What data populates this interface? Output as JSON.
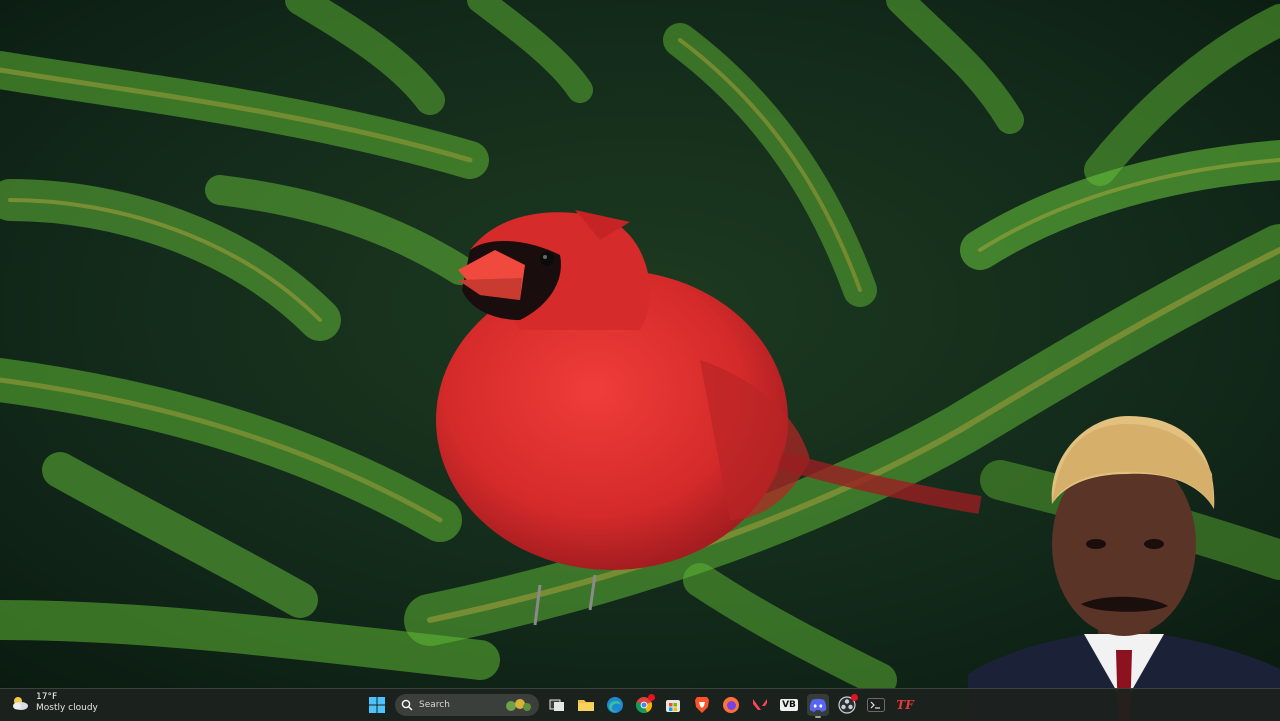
{
  "desktop": {
    "wallpaper": "northern-cardinal-on-spruce-branch",
    "overlay_photo": "man-in-suit-portrait"
  },
  "taskbar": {
    "weather": {
      "temperature": "17°F",
      "condition": "Mostly cloudy",
      "icon": "cloudy-weather-icon"
    },
    "search": {
      "label": "Search"
    },
    "apps": [
      {
        "name": "start",
        "icon": "windows-logo-icon"
      },
      {
        "name": "search",
        "icon": "search-icon"
      },
      {
        "name": "task-view",
        "icon": "task-view-icon"
      },
      {
        "name": "file-explorer",
        "icon": "folder-icon"
      },
      {
        "name": "edge",
        "icon": "edge-icon"
      },
      {
        "name": "chrome",
        "icon": "chrome-icon",
        "badge": true
      },
      {
        "name": "store",
        "icon": "store-icon"
      },
      {
        "name": "brave",
        "icon": "brave-icon"
      },
      {
        "name": "firefox",
        "icon": "firefox-icon"
      },
      {
        "name": "valorant",
        "icon": "valorant-icon"
      },
      {
        "name": "vb",
        "icon": "vb-icon"
      },
      {
        "name": "discord",
        "icon": "discord-icon",
        "active": true
      },
      {
        "name": "obs",
        "icon": "obs-icon",
        "badge": true
      },
      {
        "name": "terminal",
        "icon": "terminal-icon"
      },
      {
        "name": "tf",
        "icon": "tf-icon"
      }
    ],
    "vb_text": "VB",
    "tf_text": "TF"
  },
  "colors": {
    "taskbar_bg": "#1c221e",
    "accent": "#0078d4",
    "badge": "#e81123",
    "cardinal": "#d82a2a"
  }
}
